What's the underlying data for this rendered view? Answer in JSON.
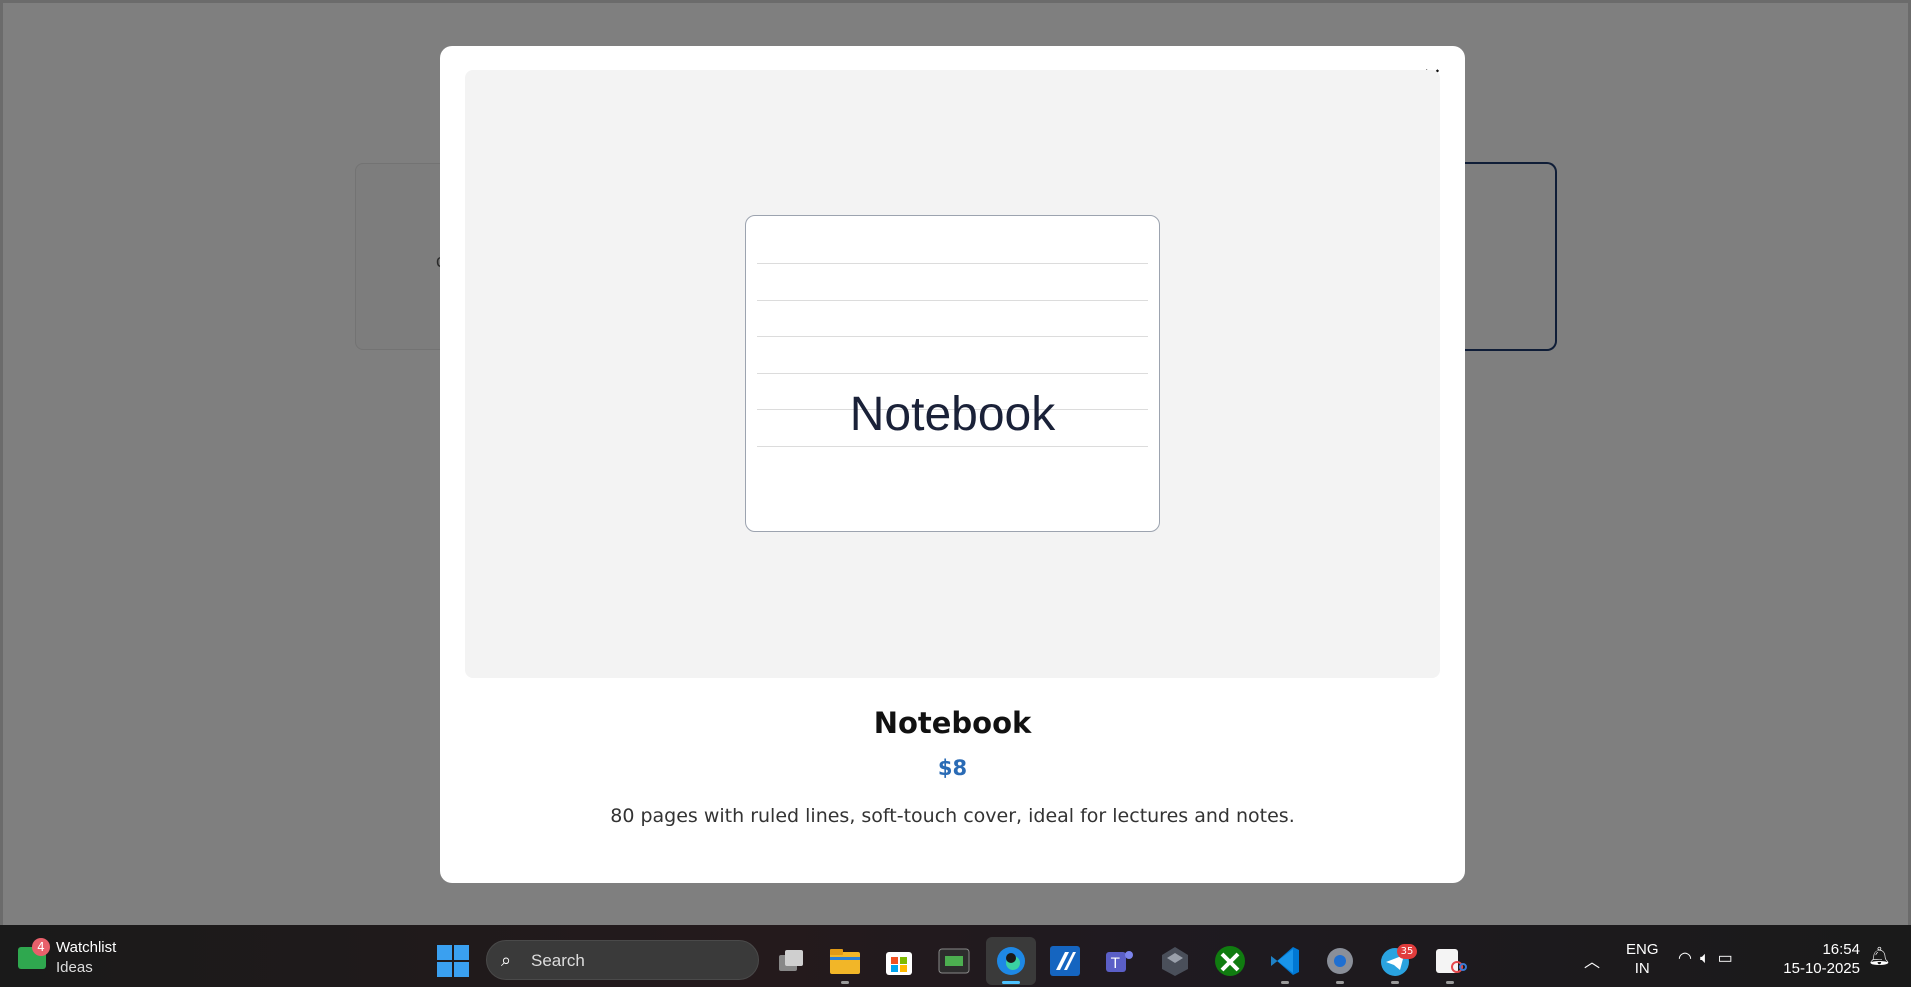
{
  "background": {
    "left_card_glyph": "c"
  },
  "modal": {
    "close_label": "✕",
    "image_text": "Notebook",
    "product_name": "Notebook",
    "price": "$8",
    "description": "80 pages with ruled lines, soft-touch cover, ideal for lectures and notes."
  },
  "taskbar": {
    "widget": {
      "title": "Watchlist",
      "subtitle": "Ideas",
      "badge": "4"
    },
    "search_placeholder": "Search",
    "apps": [
      "task-view",
      "file-explorer",
      "microsoft-store",
      "terminal",
      "edge",
      "ai-tool",
      "teams",
      "app-cube",
      "xbox",
      "vscode",
      "settings",
      "telegram",
      "snipping-tool"
    ],
    "active_app": "edge",
    "telegram_badge": "35",
    "language": {
      "line1": "ENG",
      "line2": "IN"
    },
    "clock": {
      "time": "16:54",
      "date": "15-10-2025"
    }
  },
  "colors": {
    "price": "#2a6bb5",
    "overlay": "rgba(0,0,0,0.5)",
    "image_bg": "#f3f3f3"
  }
}
